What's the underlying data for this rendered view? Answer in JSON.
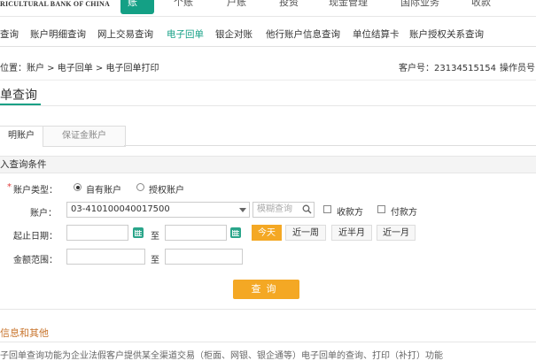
{
  "header": {
    "bank_name": "RICULTURAL BANK OF CHINA",
    "nav": [
      "账",
      "个账",
      "户账",
      "投资",
      "现金管理",
      "国际业务",
      "收款"
    ]
  },
  "subnav": {
    "items": [
      "查询",
      "账户明细查询",
      "网上交易查询",
      "电子回单",
      "银企对账",
      "他行账户信息查询",
      "单位结算卡",
      "账户授权关系查询"
    ],
    "active_index": 3
  },
  "breadcrumb": {
    "text": "位置：账户 > 电子回单 > 电子回单打印",
    "customer_label": "客户号：23134515154",
    "operator_label": "操作员号"
  },
  "page_title": "单查询",
  "tabs": {
    "own": "明账户",
    "deposit": "保证金账户"
  },
  "section_title": "入查询条件",
  "form": {
    "account_type_label": "账户类型：",
    "account_type_required": "*",
    "radio_own": "自有账户",
    "radio_authorized": "授权账户",
    "account_label": "账户：",
    "account_value": "03-410100040017500",
    "fuzzy_placeholder": "模糊查询",
    "payee_label": "收款方",
    "payer_label": "付款方",
    "start_date_label": "起止日期：",
    "to_label": "至",
    "today_label": "今天",
    "week_label": "近一周",
    "half_month_label": "近半月",
    "month_label": "近一月",
    "amount_label": "金额范围：",
    "amount_to_label": "至",
    "query_button": "查询"
  },
  "section2_title": "信息和其他",
  "description": "子回单查询功能为企业法假客户提供某全渠道交易（柜面、网银、银企通等）电子回单的查询、打印（补打）功能"
}
